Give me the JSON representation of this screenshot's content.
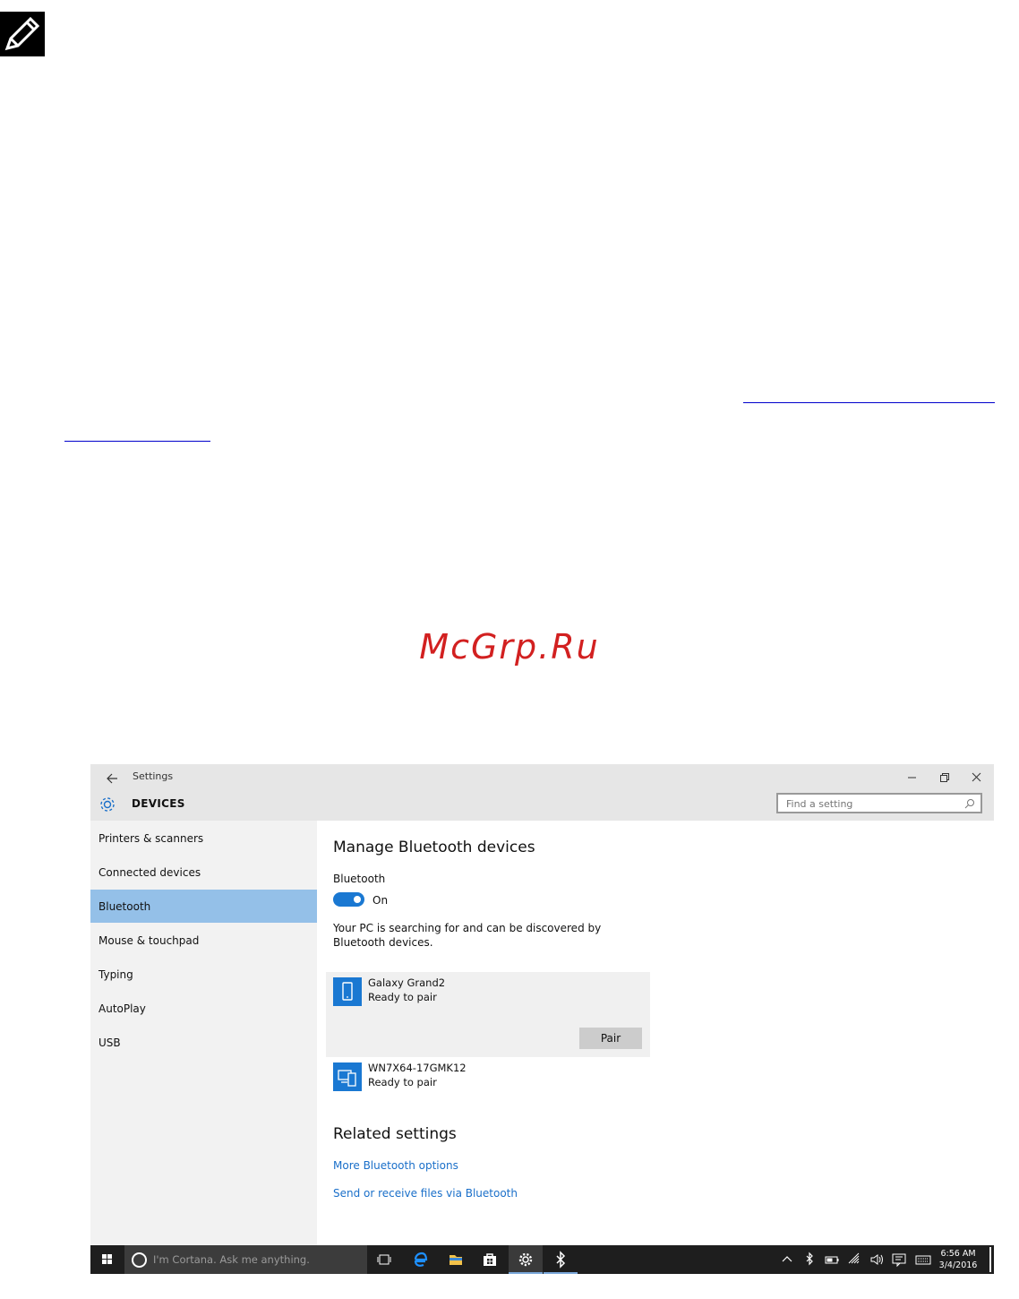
{
  "doc": {
    "note_icon": "pencil-note-icon",
    "watermark": "McGrp.Ru"
  },
  "window": {
    "app_title": "Settings",
    "section_title": "DEVICES",
    "search": {
      "placeholder": "Find a setting"
    },
    "controls": [
      "minimize-icon",
      "restore-icon",
      "close-icon"
    ]
  },
  "sidebar": {
    "items": [
      {
        "label": "Printers & scanners",
        "active": false
      },
      {
        "label": "Connected devices",
        "active": false
      },
      {
        "label": "Bluetooth",
        "active": true
      },
      {
        "label": "Mouse & touchpad",
        "active": false
      },
      {
        "label": "Typing",
        "active": false
      },
      {
        "label": "AutoPlay",
        "active": false
      },
      {
        "label": "USB",
        "active": false
      }
    ]
  },
  "main": {
    "heading": "Manage Bluetooth devices",
    "bluetooth_label": "Bluetooth",
    "toggle_state": "On",
    "description": "Your PC is searching for and can be discovered by Bluetooth devices.",
    "devices": [
      {
        "name": "Galaxy Grand2",
        "status": "Ready to pair",
        "icon": "phone-icon",
        "action": "Pair"
      },
      {
        "name": "WN7X64-17GMK12",
        "status": "Ready to pair",
        "icon": "computer-icon"
      }
    ],
    "related_heading": "Related settings",
    "links": [
      "More Bluetooth options",
      "Send or receive files via Bluetooth"
    ]
  },
  "taskbar": {
    "cortana_placeholder": "I'm Cortana. Ask me anything.",
    "time": "6:56 AM",
    "date": "3/4/2016"
  },
  "colors": {
    "accent": "#1a78d2",
    "selected": "#94c0e8",
    "link": "#1a6fc9",
    "watermark": "#d22020"
  }
}
